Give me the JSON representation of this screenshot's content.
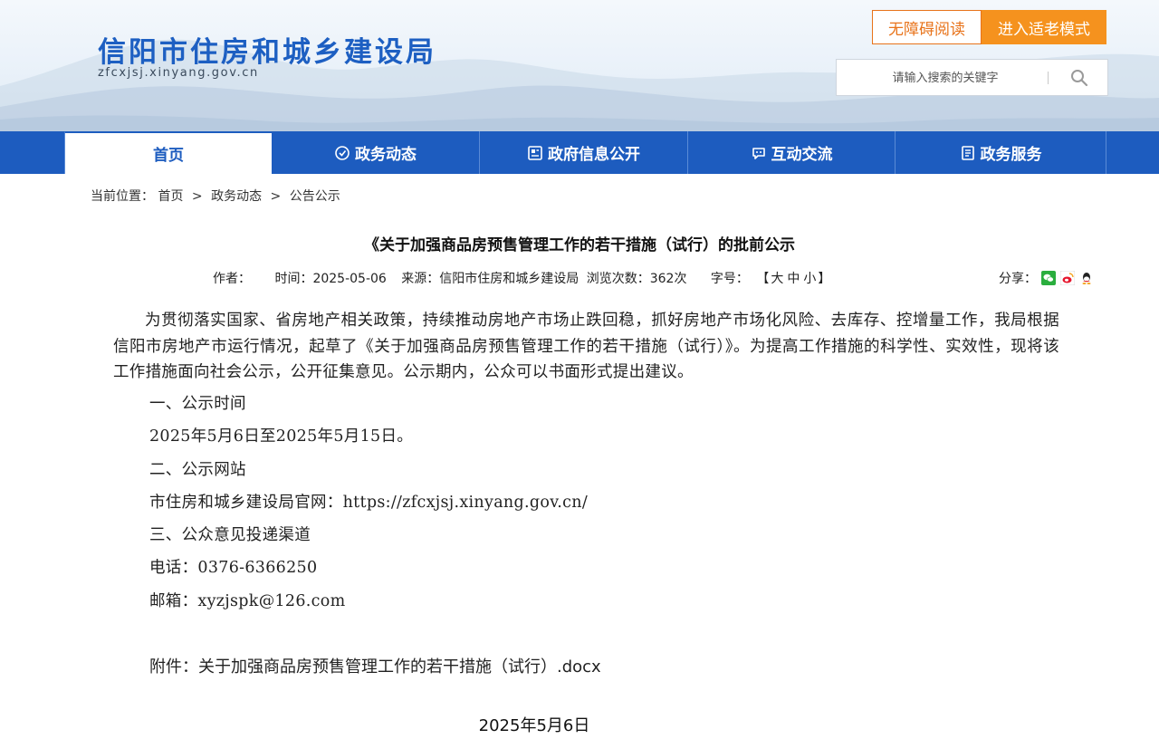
{
  "header": {
    "site_title": "信阳市住房和城乡建设局",
    "site_domain": "zfcxjsj.xinyang.gov.cn",
    "accessibility_label": "无障碍阅读",
    "elder_mode_label": "进入适老模式",
    "search_placeholder": "请输入搜索的关键字",
    "colors": {
      "brand_blue": "#1d5cbf",
      "accent_orange": "#f5921e"
    }
  },
  "nav": {
    "items": [
      {
        "label": "首页",
        "icon": ""
      },
      {
        "label": "政务动态",
        "icon": "news-icon"
      },
      {
        "label": "政府信息公开",
        "icon": "info-icon"
      },
      {
        "label": "互动交流",
        "icon": "chat-icon"
      },
      {
        "label": "政务服务",
        "icon": "service-icon"
      }
    ]
  },
  "breadcrumb": {
    "prefix": "当前位置：",
    "items": [
      "首页",
      "政务动态",
      "公告公示"
    ],
    "separator": ">"
  },
  "article": {
    "title": "《关于加强商品房预售管理工作的若干措施（试行）的批前公示",
    "meta": {
      "author_label": "作者：",
      "time_label": "时间：",
      "time_value": "2025-05-06",
      "source_label": "来源：",
      "source_value": "信阳市住房和城乡建设局",
      "views_label": "浏览次数：",
      "views_value": "362次",
      "fontsize_label": "字号：",
      "fontsize_open": "【",
      "fontsize_large": "大",
      "fontsize_medium": "中",
      "fontsize_small": "小",
      "fontsize_close": "】"
    },
    "share_label": "分享：",
    "share_icons": [
      "wechat-icon",
      "weibo-icon",
      "qq-icon"
    ],
    "intro": "为贯彻落实国家、省房地产相关政策，持续推动房地产市场止跌回稳，抓好房地产市场化风险、去库存、控增量工作，我局根据信阳市房地产市运行情况，起草了《关于加强商品房预售管理工作的若干措施（试行）》。为提高工作措施的科学性、实效性，现将该工作措施面向社会公示，公开征集意见。公示期内，公众可以书面形式提出建议。",
    "lines": [
      "一、公示时间",
      "2025年5月6日至2025年5月15日。",
      "二、公示网站",
      "市住房和城乡建设局官网：https://zfcxjsj.xinyang.gov.cn/",
      "三、公众意见投递渠道",
      "电话：0376-6366250",
      "邮箱：xyzjspk@126.com"
    ],
    "attachment_label": "附件：",
    "attachment_name": "关于加强商品房预售管理工作的若干措施（试行）.docx",
    "publish_date": "2025年5月6日"
  }
}
